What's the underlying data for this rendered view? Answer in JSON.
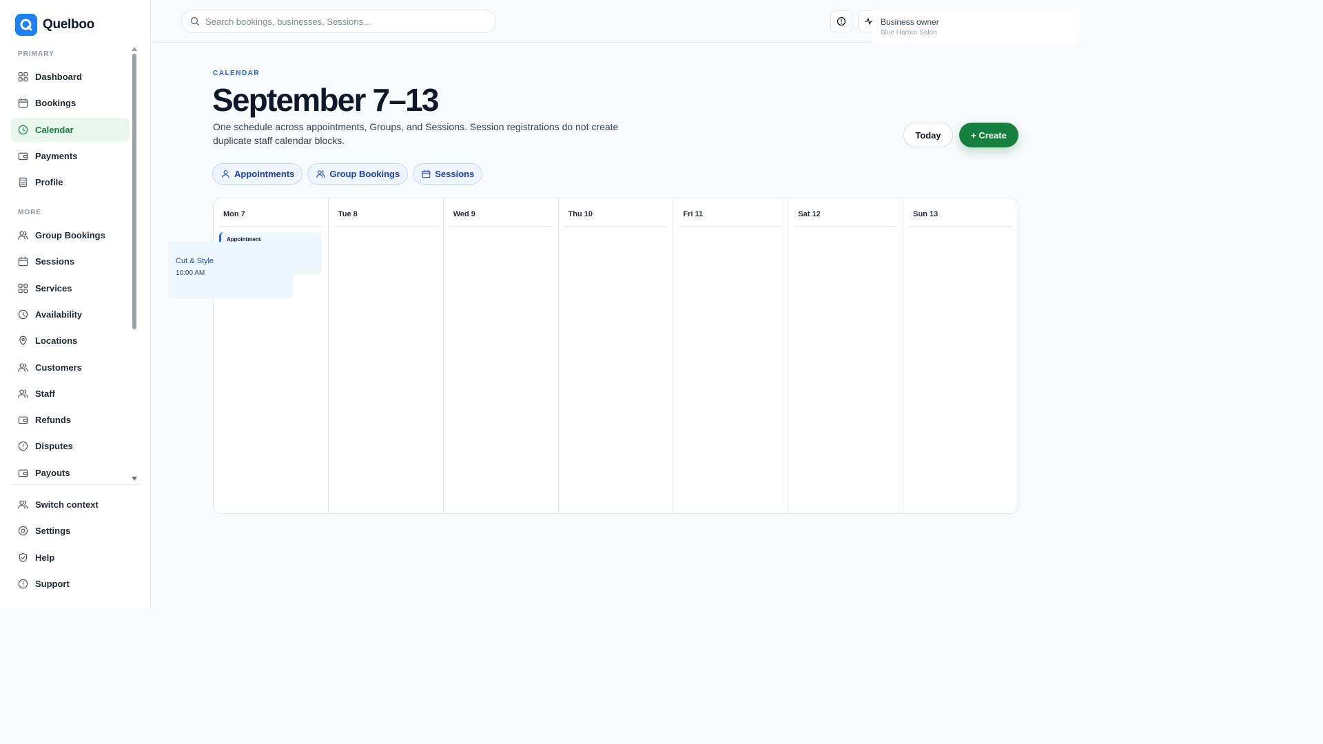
{
  "app": {
    "name": "Quelboo"
  },
  "search": {
    "placeholder": "Search bookings, businesses, Sessions..."
  },
  "user": {
    "role": "Business owner",
    "org": "Blue Harbor Salon"
  },
  "sidebar": {
    "primary_label": "PRIMARY",
    "primary": [
      {
        "label": "Dashboard",
        "icon": "grid-icon"
      },
      {
        "label": "Bookings",
        "icon": "calendar-icon"
      },
      {
        "label": "Calendar",
        "icon": "clock-icon",
        "active": true
      },
      {
        "label": "Payments",
        "icon": "wallet-icon"
      },
      {
        "label": "Profile",
        "icon": "building-icon"
      }
    ],
    "more_label": "MORE",
    "more": [
      {
        "label": "Group Bookings",
        "icon": "users-icon"
      },
      {
        "label": "Sessions",
        "icon": "calendar-icon"
      },
      {
        "label": "Services",
        "icon": "grid-icon"
      },
      {
        "label": "Availability",
        "icon": "clock-icon"
      },
      {
        "label": "Locations",
        "icon": "pin-icon"
      },
      {
        "label": "Customers",
        "icon": "users-icon"
      },
      {
        "label": "Staff",
        "icon": "users-icon"
      },
      {
        "label": "Refunds",
        "icon": "wallet-icon"
      },
      {
        "label": "Disputes",
        "icon": "alert-icon"
      },
      {
        "label": "Payouts",
        "icon": "wallet-icon"
      }
    ],
    "footer": [
      {
        "label": "Switch context",
        "icon": "users-icon"
      },
      {
        "label": "Settings",
        "icon": "settings-icon"
      },
      {
        "label": "Help",
        "icon": "shield-icon"
      },
      {
        "label": "Support",
        "icon": "alert-icon"
      }
    ]
  },
  "header": {
    "eyebrow": "CALENDAR",
    "title": "September 7–13",
    "description": "One schedule across appointments, Groups, and Sessions. Session registrations do not create duplicate staff calendar blocks.",
    "today_label": "Today",
    "create_label": "+ Create"
  },
  "filters": [
    {
      "label": "Appointments",
      "icon": "user-icon"
    },
    {
      "label": "Group Bookings",
      "icon": "users-icon"
    },
    {
      "label": "Sessions",
      "icon": "calendar-icon"
    }
  ],
  "calendar": {
    "days": [
      "Mon 7",
      "Tue 8",
      "Wed 9",
      "Thu 10",
      "Fri 11",
      "Sat 12",
      "Sun 13"
    ],
    "event": {
      "type": "Appointment",
      "title": "Cut & Style",
      "time": "10:00 AM"
    }
  },
  "colors": {
    "accent": "#15803d",
    "brand": "#1d7ff2",
    "link": "#2563eb"
  }
}
